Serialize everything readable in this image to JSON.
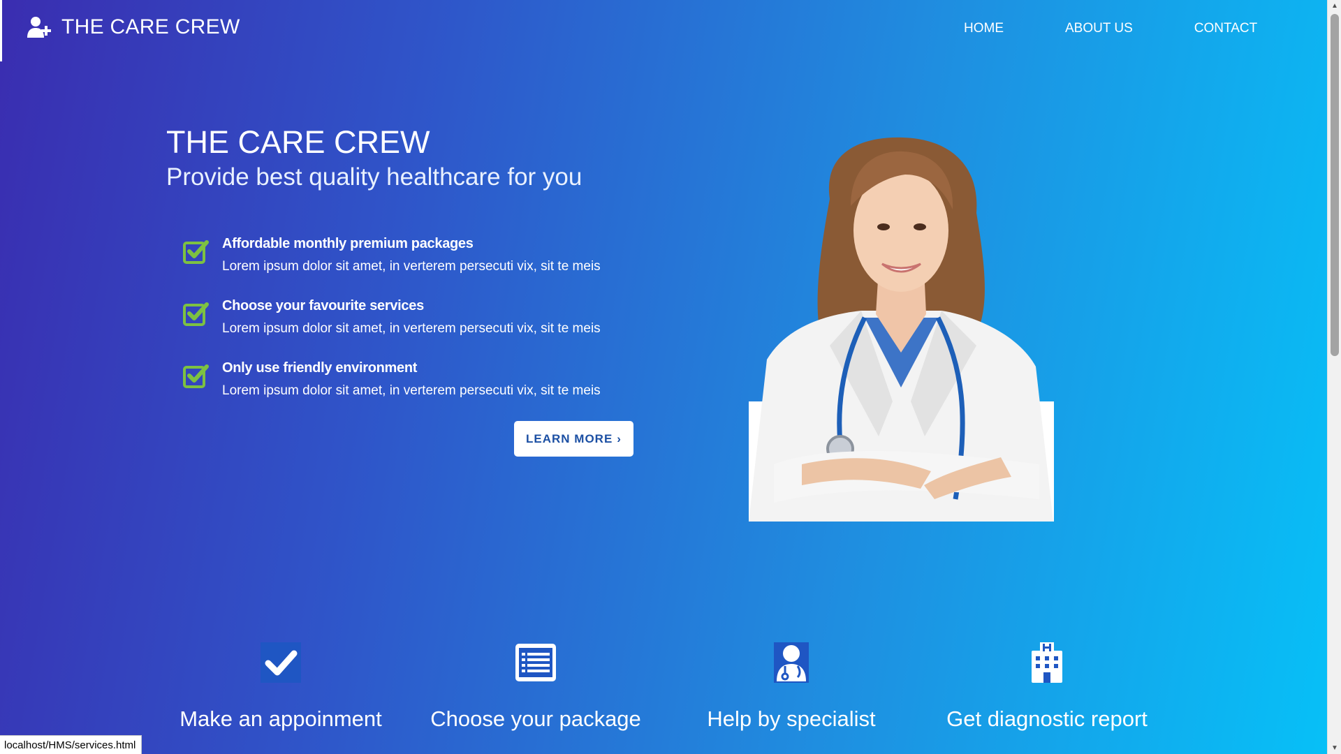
{
  "header": {
    "brand": "THE CARE CREW",
    "brand_icon": "user-plus-icon",
    "nav": [
      {
        "label": "HOME"
      },
      {
        "label": "ABOUT US"
      },
      {
        "label": "CONTACT"
      }
    ]
  },
  "hero": {
    "title": "THE CARE CREW",
    "subtitle": "Provide best quality healthcare for you",
    "features": [
      {
        "title": "Affordable monthly premium packages",
        "text": "Lorem ipsum dolor sit amet, in verterem persecuti vix, sit te meis",
        "icon": "check-square-icon"
      },
      {
        "title": "Choose your favourite services",
        "text": "Lorem ipsum dolor sit amet, in verterem persecuti vix, sit te meis",
        "icon": "check-square-icon"
      },
      {
        "title": "Only use friendly environment",
        "text": "Lorem ipsum dolor sit amet, in verterem persecuti vix, sit te meis",
        "icon": "check-square-icon"
      }
    ],
    "button_label": "LEARN MORE",
    "image": "doctor-photo"
  },
  "services": [
    {
      "label": "Make an appoinment",
      "icon": "check-box-icon"
    },
    {
      "label": "Choose your package",
      "icon": "list-icon"
    },
    {
      "label": "Help by specialist",
      "icon": "doctor-icon"
    },
    {
      "label": "Get diagnostic report",
      "icon": "hospital-icon"
    }
  ],
  "statusbar": {
    "url": "localhost/HMS/services.html"
  },
  "colors": {
    "gradient_start": "#3a2db0",
    "gradient_end": "#07c0f7",
    "check_green": "#7dc142",
    "button_text": "#1b4fa3"
  }
}
